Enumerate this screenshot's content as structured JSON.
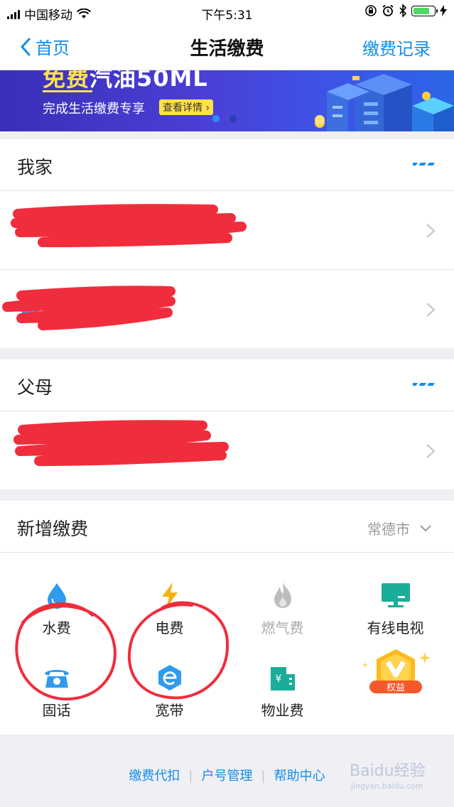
{
  "status_bar": {
    "carrier": "中国移动",
    "time": "下午5:31"
  },
  "nav": {
    "back_label": "首页",
    "title": "生活缴费",
    "right_label": "缴费记录"
  },
  "banner": {
    "headline_highlight": "免费",
    "headline_rest": "汽油50ML",
    "subtitle": "完成生活缴费专享",
    "button": "查看详情"
  },
  "groups": [
    {
      "title": "我家",
      "rows": 2
    },
    {
      "title": "父母",
      "rows": 1
    }
  ],
  "add": {
    "title": "新增缴费",
    "city": "常德市",
    "items": [
      {
        "label": "水费",
        "icon": "water-drop-icon"
      },
      {
        "label": "电费",
        "icon": "lightning-icon"
      },
      {
        "label": "燃气费",
        "icon": "flame-icon"
      },
      {
        "label": "有线电视",
        "icon": "tv-icon"
      },
      {
        "label": "固话",
        "icon": "telephone-icon"
      },
      {
        "label": "宽带",
        "icon": "broadband-icon"
      },
      {
        "label": "物业费",
        "icon": "building-icon"
      }
    ],
    "badge_label": "权益"
  },
  "footer": {
    "links": [
      "缴费代扣",
      "户号管理",
      "帮助中心"
    ]
  },
  "watermark": {
    "brand": "Baidu经验",
    "url": "jingyan.baidu.com"
  },
  "colors": {
    "accent": "#108ee9",
    "annotation": "#f02d3c"
  }
}
